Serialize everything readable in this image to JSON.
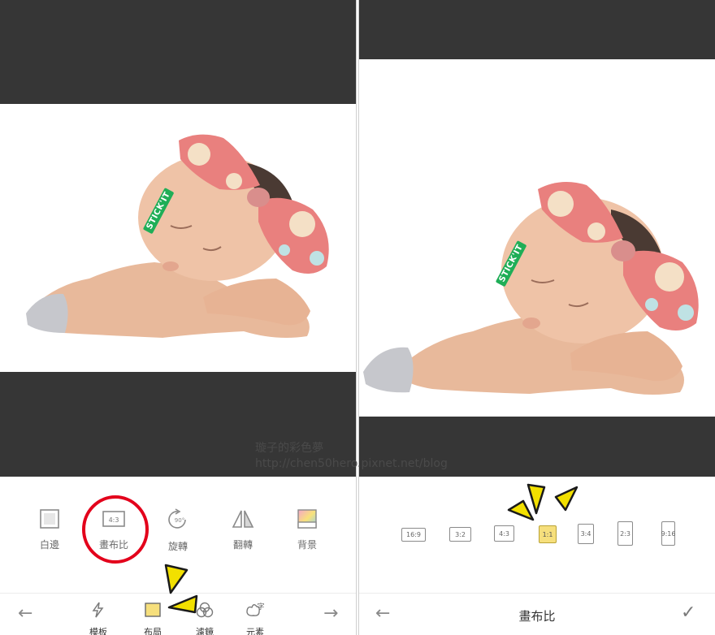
{
  "left": {
    "sticker": "STICK'IT",
    "tools": [
      {
        "label": "白邊",
        "icon": "border-icon"
      },
      {
        "label": "畫布比",
        "icon": "canvas-ratio-icon",
        "badge": "4:3"
      },
      {
        "label": "旋轉",
        "icon": "rotate-icon",
        "badge": "90°"
      },
      {
        "label": "翻轉",
        "icon": "flip-icon"
      },
      {
        "label": "背景",
        "icon": "background-icon"
      }
    ],
    "bottom_nav": [
      {
        "label": "模板",
        "icon": "template-icon"
      },
      {
        "label": "布局",
        "icon": "layout-icon"
      },
      {
        "label": "濾鏡",
        "icon": "filter-icon"
      },
      {
        "label": "元素",
        "icon": "element-icon",
        "badge": "字"
      }
    ],
    "back_arrow": "←",
    "next_arrow": "→"
  },
  "right": {
    "sticker": "STICK'IT",
    "ratios": [
      "16:9",
      "3:2",
      "4:3",
      "1:1",
      "3:4",
      "2:3",
      "9:16"
    ],
    "selected_ratio": "1:1",
    "title": "畫布比",
    "back_arrow": "←",
    "confirm": "✓"
  },
  "watermark": {
    "line1": "璇子的彩色夢",
    "line2": "http://chen50hero.pixnet.net/blog"
  },
  "colors": {
    "dark_band": "#363636",
    "highlight_circle": "#e3001b",
    "annotation_yellow": "#f2e000",
    "selected_ratio": "#f6df7c",
    "sticker_green": "#1fae57"
  }
}
